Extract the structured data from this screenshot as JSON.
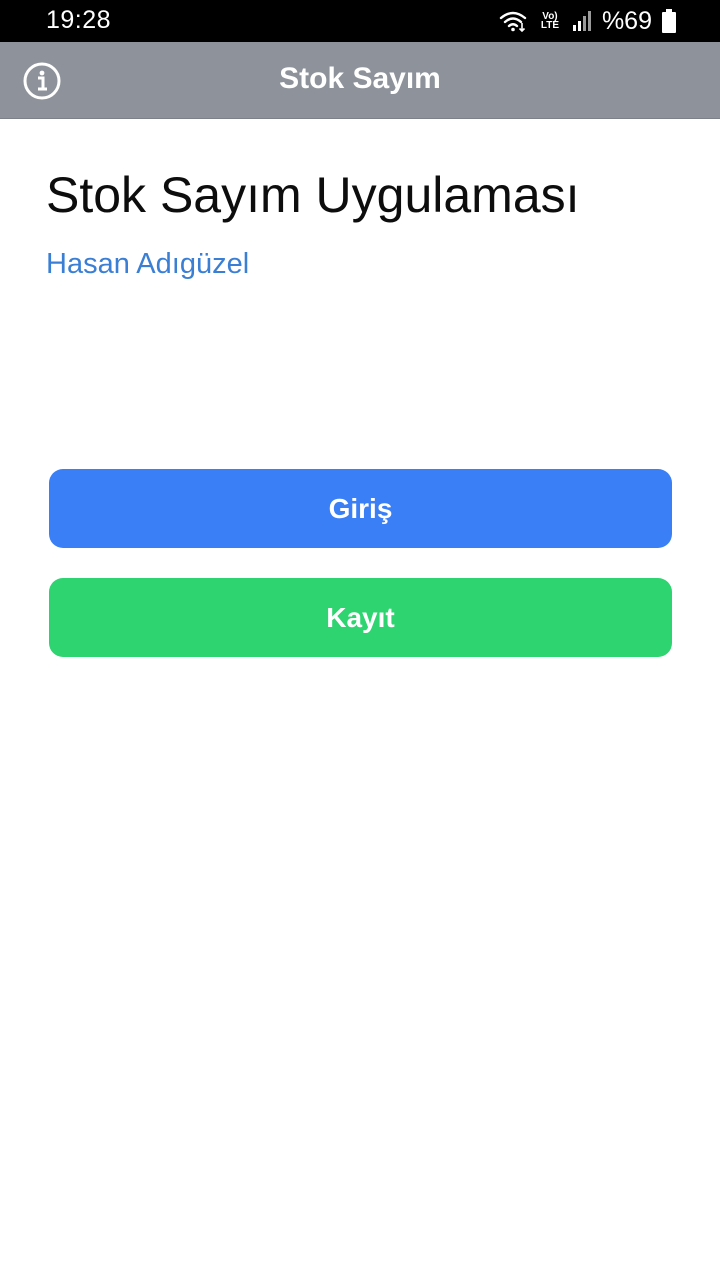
{
  "status_bar": {
    "time": "19:28",
    "volte_line1": "Vo)",
    "volte_line2": "LTE",
    "battery": "%69",
    "icons": [
      "wifi-icon",
      "volte-icon",
      "signal-icon",
      "battery-icon"
    ]
  },
  "app_bar": {
    "title": "Stok Sayım",
    "info_icon": "info-icon",
    "background": "#8e939b"
  },
  "main": {
    "title": "Stok Sayım Uygulaması",
    "subtitle": "Hasan Adıgüzel",
    "subtitle_color": "#3b7fd4"
  },
  "actions": {
    "login_label": "Giriş",
    "login_color": "#3a7ff6",
    "register_label": "Kayıt",
    "register_color": "#2ed46f"
  }
}
